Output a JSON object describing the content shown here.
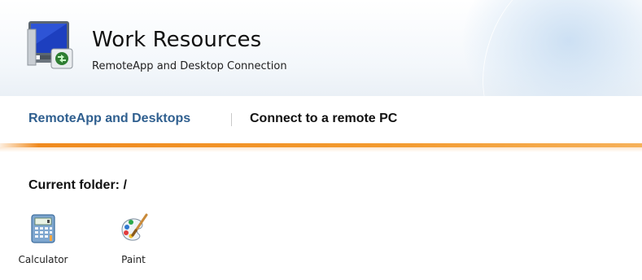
{
  "header": {
    "title": "Work Resources",
    "subtitle": "RemoteApp and Desktop Connection",
    "logo_icon": "remote-desktop-monitor-icon"
  },
  "nav": {
    "tabs": [
      {
        "label": "RemoteApp and Desktops",
        "active": true
      },
      {
        "label": "Connect to a remote PC",
        "active": false
      }
    ]
  },
  "folder": {
    "label": "Current folder: /"
  },
  "apps": [
    {
      "label": "Calculator",
      "icon": "calculator-icon"
    },
    {
      "label": "Paint",
      "icon": "paint-palette-icon"
    }
  ],
  "colors": {
    "active_tab": "#2f5f8f",
    "accent_bar": "#f08a1e",
    "header_bg": "#eaf0f6"
  }
}
